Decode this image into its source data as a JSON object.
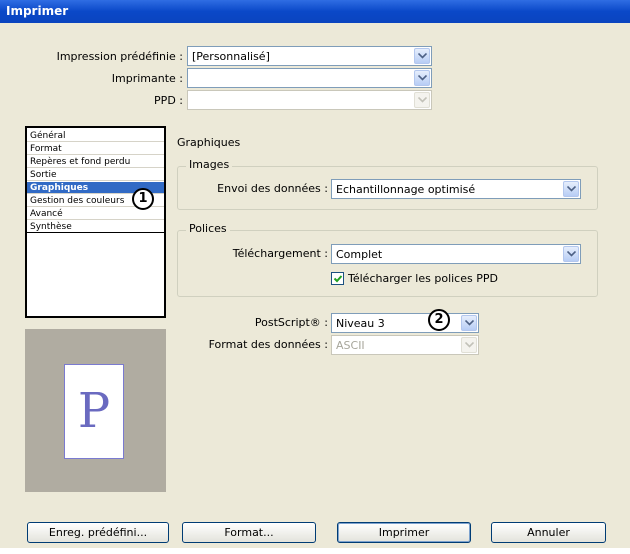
{
  "window": {
    "title": "Imprimer"
  },
  "top_fields": {
    "preset": {
      "label": "Impression prédéfinie :",
      "value": "[Personnalisé]"
    },
    "printer": {
      "label": "Imprimante :",
      "value": ""
    },
    "ppd": {
      "label": "PPD :",
      "value": ""
    }
  },
  "sidebar": {
    "items": [
      {
        "label": "Général"
      },
      {
        "label": "Format"
      },
      {
        "label": "Repères et fond perdu"
      },
      {
        "label": "Sortie"
      },
      {
        "label": "Graphiques",
        "selected": true
      },
      {
        "label": "Gestion des couleurs"
      },
      {
        "label": "Avancé"
      },
      {
        "label": "Synthèse"
      }
    ]
  },
  "preview": {
    "letter": "P"
  },
  "panel": {
    "heading": "Graphiques",
    "images": {
      "title": "Images",
      "send_data_label": "Envoi des données :",
      "send_data_value": "Echantillonnage optimisé"
    },
    "fonts": {
      "title": "Polices",
      "download_label": "Téléchargement :",
      "download_value": "Complet",
      "ppd_fonts_checkbox_label": "Télécharger les polices PPD",
      "ppd_fonts_checked": true
    },
    "postscript": {
      "label": "PostScript® :",
      "value": "Niveau 3"
    },
    "data_format": {
      "label": "Format des données :",
      "value": "ASCII"
    }
  },
  "callouts": {
    "one": "1",
    "two": "2"
  },
  "buttons": {
    "save_preset": "Enreg. prédéfini...",
    "format": "Format...",
    "print": "Imprimer",
    "cancel": "Annuler"
  },
  "colors": {
    "titlebar": "#0a48c8",
    "selection": "#316ac5",
    "dialog_bg": "#ece9d8"
  },
  "icons": {
    "dropdown": "chevron-down-icon",
    "check": "checkmark-icon"
  }
}
